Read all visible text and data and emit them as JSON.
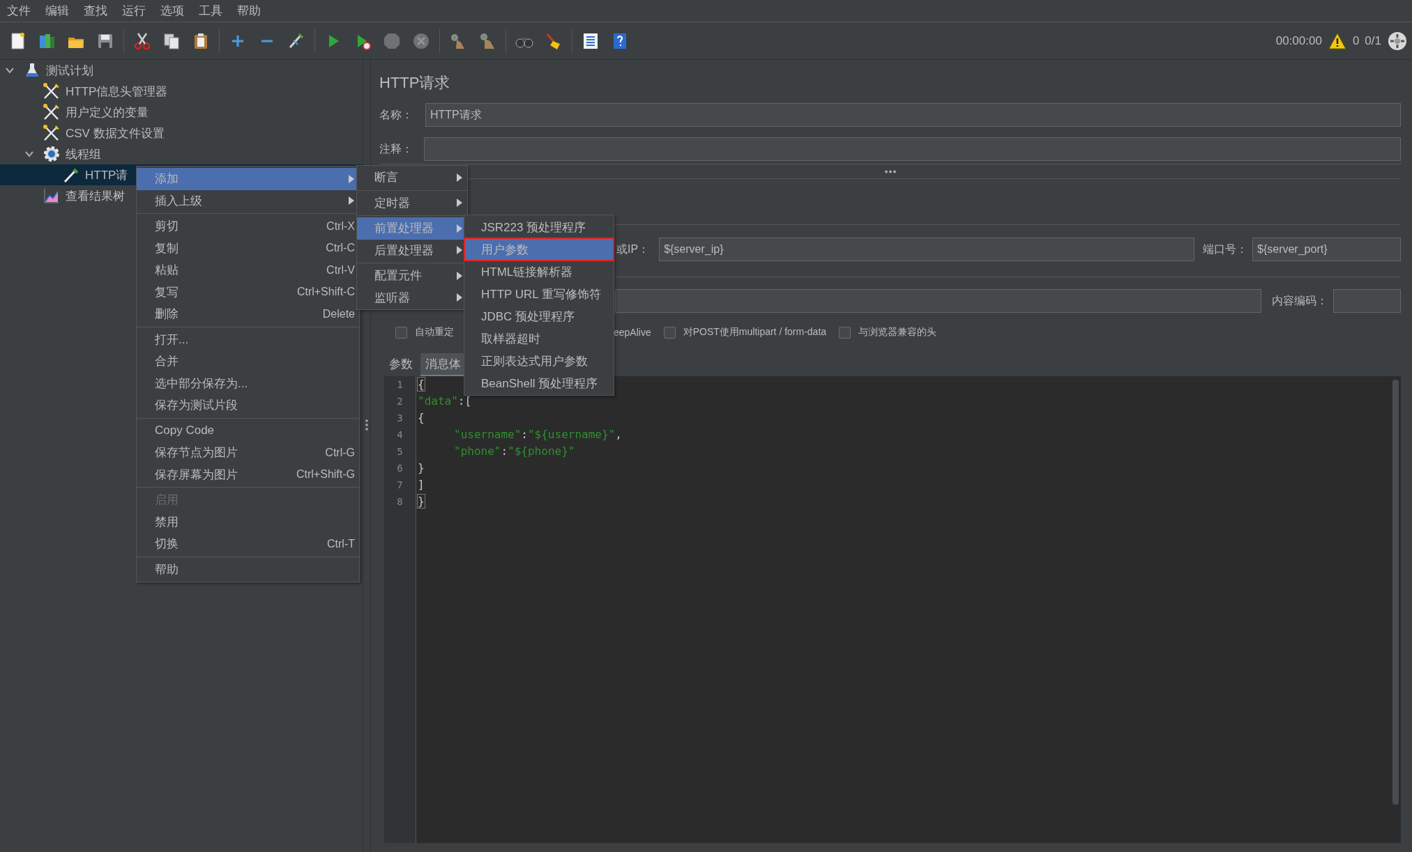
{
  "menubar": [
    "文件",
    "编辑",
    "查找",
    "运行",
    "选项",
    "工具",
    "帮助"
  ],
  "toolbar": [
    {
      "kind": "new",
      "disabled": false
    },
    {
      "kind": "templates",
      "disabled": false
    },
    {
      "kind": "open",
      "disabled": false
    },
    {
      "kind": "save",
      "disabled": false
    },
    {
      "kind": "separator"
    },
    {
      "kind": "cut",
      "disabled": false
    },
    {
      "kind": "copy",
      "disabled": false
    },
    {
      "kind": "paste",
      "disabled": false
    },
    {
      "kind": "separator"
    },
    {
      "kind": "expand",
      "disabled": false
    },
    {
      "kind": "collapse",
      "disabled": false
    },
    {
      "kind": "toggle",
      "disabled": false
    },
    {
      "kind": "separator"
    },
    {
      "kind": "start",
      "disabled": false
    },
    {
      "kind": "start-no-pause",
      "disabled": false
    },
    {
      "kind": "stop",
      "disabled": true
    },
    {
      "kind": "shutdown",
      "disabled": true
    },
    {
      "kind": "separator"
    },
    {
      "kind": "clear",
      "disabled": false
    },
    {
      "kind": "clear-all",
      "disabled": false
    },
    {
      "kind": "separator"
    },
    {
      "kind": "search",
      "disabled": false
    },
    {
      "kind": "reset-search",
      "disabled": false
    },
    {
      "kind": "separator"
    },
    {
      "kind": "function-helper",
      "disabled": false
    },
    {
      "kind": "help",
      "disabled": false
    }
  ],
  "run_status": {
    "elapsed": "00:00:00",
    "warnings": "0",
    "threads": "0/1"
  },
  "tree": [
    {
      "label": "测试计划",
      "kind": "plan",
      "expanded": true,
      "selected": false,
      "children": [
        {
          "label": "HTTP信息头管理器",
          "kind": "config",
          "selected": false
        },
        {
          "label": "用户定义的变量",
          "kind": "config",
          "selected": false
        },
        {
          "label": "CSV 数据文件设置",
          "kind": "config",
          "selected": false
        },
        {
          "label": "线程组",
          "kind": "threads",
          "expanded": true,
          "selected": false,
          "children": [
            {
              "label": "HTTP请",
              "kind": "sampler",
              "selected": true
            }
          ]
        },
        {
          "label": "查看结果树",
          "kind": "listener",
          "selected": false
        }
      ]
    }
  ],
  "context_menu": [
    {
      "kind": "item",
      "label": "添加",
      "submenu": true,
      "selected": true,
      "disabled": false
    },
    {
      "kind": "item",
      "label": "插入上级",
      "submenu": true,
      "selected": false,
      "disabled": false
    },
    {
      "kind": "separator"
    },
    {
      "kind": "item",
      "label": "剪切",
      "shortcut": "Ctrl-X",
      "submenu": false,
      "selected": false,
      "disabled": false
    },
    {
      "kind": "item",
      "label": "复制",
      "shortcut": "Ctrl-C",
      "submenu": false,
      "selected": false,
      "disabled": false
    },
    {
      "kind": "item",
      "label": "粘贴",
      "shortcut": "Ctrl-V",
      "submenu": false,
      "selected": false,
      "disabled": false
    },
    {
      "kind": "item",
      "label": "复写",
      "shortcut": "Ctrl+Shift-C",
      "submenu": false,
      "selected": false,
      "disabled": false
    },
    {
      "kind": "item",
      "label": "删除",
      "shortcut": "Delete",
      "submenu": false,
      "selected": false,
      "disabled": false
    },
    {
      "kind": "separator"
    },
    {
      "kind": "item",
      "label": "打开...",
      "submenu": false,
      "selected": false,
      "disabled": false
    },
    {
      "kind": "item",
      "label": "合并",
      "submenu": false,
      "selected": false,
      "disabled": false
    },
    {
      "kind": "item",
      "label": "选中部分保存为...",
      "submenu": false,
      "selected": false,
      "disabled": false
    },
    {
      "kind": "item",
      "label": "保存为测试片段",
      "submenu": false,
      "selected": false,
      "disabled": false
    },
    {
      "kind": "separator"
    },
    {
      "kind": "item",
      "label": "Copy Code",
      "submenu": false,
      "selected": false,
      "disabled": false
    },
    {
      "kind": "item",
      "label": "保存节点为图片",
      "shortcut": "Ctrl-G",
      "submenu": false,
      "selected": false,
      "disabled": false
    },
    {
      "kind": "item",
      "label": "保存屏幕为图片",
      "shortcut": "Ctrl+Shift-G",
      "submenu": false,
      "selected": false,
      "disabled": false
    },
    {
      "kind": "separator"
    },
    {
      "kind": "item",
      "label": "启用",
      "submenu": false,
      "selected": false,
      "disabled": true
    },
    {
      "kind": "item",
      "label": "禁用",
      "submenu": false,
      "selected": false,
      "disabled": false
    },
    {
      "kind": "item",
      "label": "切换",
      "shortcut": "Ctrl-T",
      "submenu": false,
      "selected": false,
      "disabled": false
    },
    {
      "kind": "separator"
    },
    {
      "kind": "item",
      "label": "帮助",
      "submenu": false,
      "selected": false,
      "disabled": false
    }
  ],
  "add_submenu": [
    {
      "kind": "item",
      "label": "断言",
      "submenu": true,
      "selected": false
    },
    {
      "kind": "separator"
    },
    {
      "kind": "item",
      "label": "定时器",
      "submenu": true,
      "selected": false
    },
    {
      "kind": "separator"
    },
    {
      "kind": "item",
      "label": "前置处理器",
      "submenu": true,
      "selected": true
    },
    {
      "kind": "item",
      "label": "后置处理器",
      "submenu": true,
      "selected": false
    },
    {
      "kind": "separator"
    },
    {
      "kind": "item",
      "label": "配置元件",
      "submenu": true,
      "selected": false
    },
    {
      "kind": "item",
      "label": "监听器",
      "submenu": true,
      "selected": false
    }
  ],
  "preprocessor_submenu": [
    {
      "label": "JSR223 预处理程序",
      "selected": false,
      "highlighted": false
    },
    {
      "label": "用户参数",
      "selected": true,
      "highlighted": true
    },
    {
      "label": "HTML链接解析器",
      "selected": false,
      "highlighted": false
    },
    {
      "label": "HTTP URL 重写修饰符",
      "selected": false,
      "highlighted": false
    },
    {
      "label": "JDBC 预处理程序",
      "selected": false,
      "highlighted": false
    },
    {
      "label": "取样器超时",
      "selected": false,
      "highlighted": false
    },
    {
      "label": "正则表达式用户参数",
      "selected": false,
      "highlighted": false
    },
    {
      "label": "BeanShell 预处理程序",
      "selected": false,
      "highlighted": false
    }
  ],
  "sampler": {
    "title": "HTTP请求",
    "name_label": "名称：",
    "name": "HTTP请求",
    "comment_label": "注释：",
    "server_label": "或IP：",
    "server": "${server_ip}",
    "port_label": "端口号：",
    "port": "${server_port}",
    "encoding_label": "内容编码：",
    "options": [
      {
        "label": "自动重定",
        "checked": false
      },
      {
        "label": "eepAlive"
      },
      {
        "label": "对POST使用multipart / form-data",
        "checked": false
      },
      {
        "label": "与浏览器兼容的头",
        "checked": false
      }
    ],
    "tabs": [
      {
        "label": "参数",
        "selected": false
      },
      {
        "label": "消息体",
        "selected": true
      }
    ],
    "code": [
      {
        "number": "1",
        "kind": "plain",
        "tokens": [
          {
            "text": "{",
            "kind": "brace-match"
          }
        ]
      },
      {
        "number": "2",
        "kind": "plain",
        "tokens": [
          {
            "text": "\"data\"",
            "kind": "string"
          },
          {
            "text": ":[",
            "kind": "punct"
          }
        ]
      },
      {
        "number": "3",
        "kind": "plain",
        "tokens": [
          {
            "text": "{",
            "kind": "punct"
          }
        ]
      },
      {
        "number": "4",
        "kind": "indented",
        "tokens": [
          {
            "text": "\"username\"",
            "kind": "string"
          },
          {
            "text": ":",
            "kind": "punct"
          },
          {
            "text": "\"${username}\"",
            "kind": "string"
          },
          {
            "text": ",",
            "kind": "punct"
          }
        ]
      },
      {
        "number": "5",
        "kind": "indented",
        "tokens": [
          {
            "text": "\"phone\"",
            "kind": "string"
          },
          {
            "text": ":",
            "kind": "punct"
          },
          {
            "text": "\"${phone}\"",
            "kind": "string"
          }
        ]
      },
      {
        "number": "6",
        "kind": "plain",
        "tokens": [
          {
            "text": "}",
            "kind": "punct"
          }
        ]
      },
      {
        "number": "7",
        "kind": "plain",
        "tokens": [
          {
            "text": "]",
            "kind": "punct"
          }
        ]
      },
      {
        "number": "8",
        "kind": "plain",
        "tokens": [
          {
            "text": "}",
            "kind": "brace-match"
          }
        ]
      }
    ]
  }
}
